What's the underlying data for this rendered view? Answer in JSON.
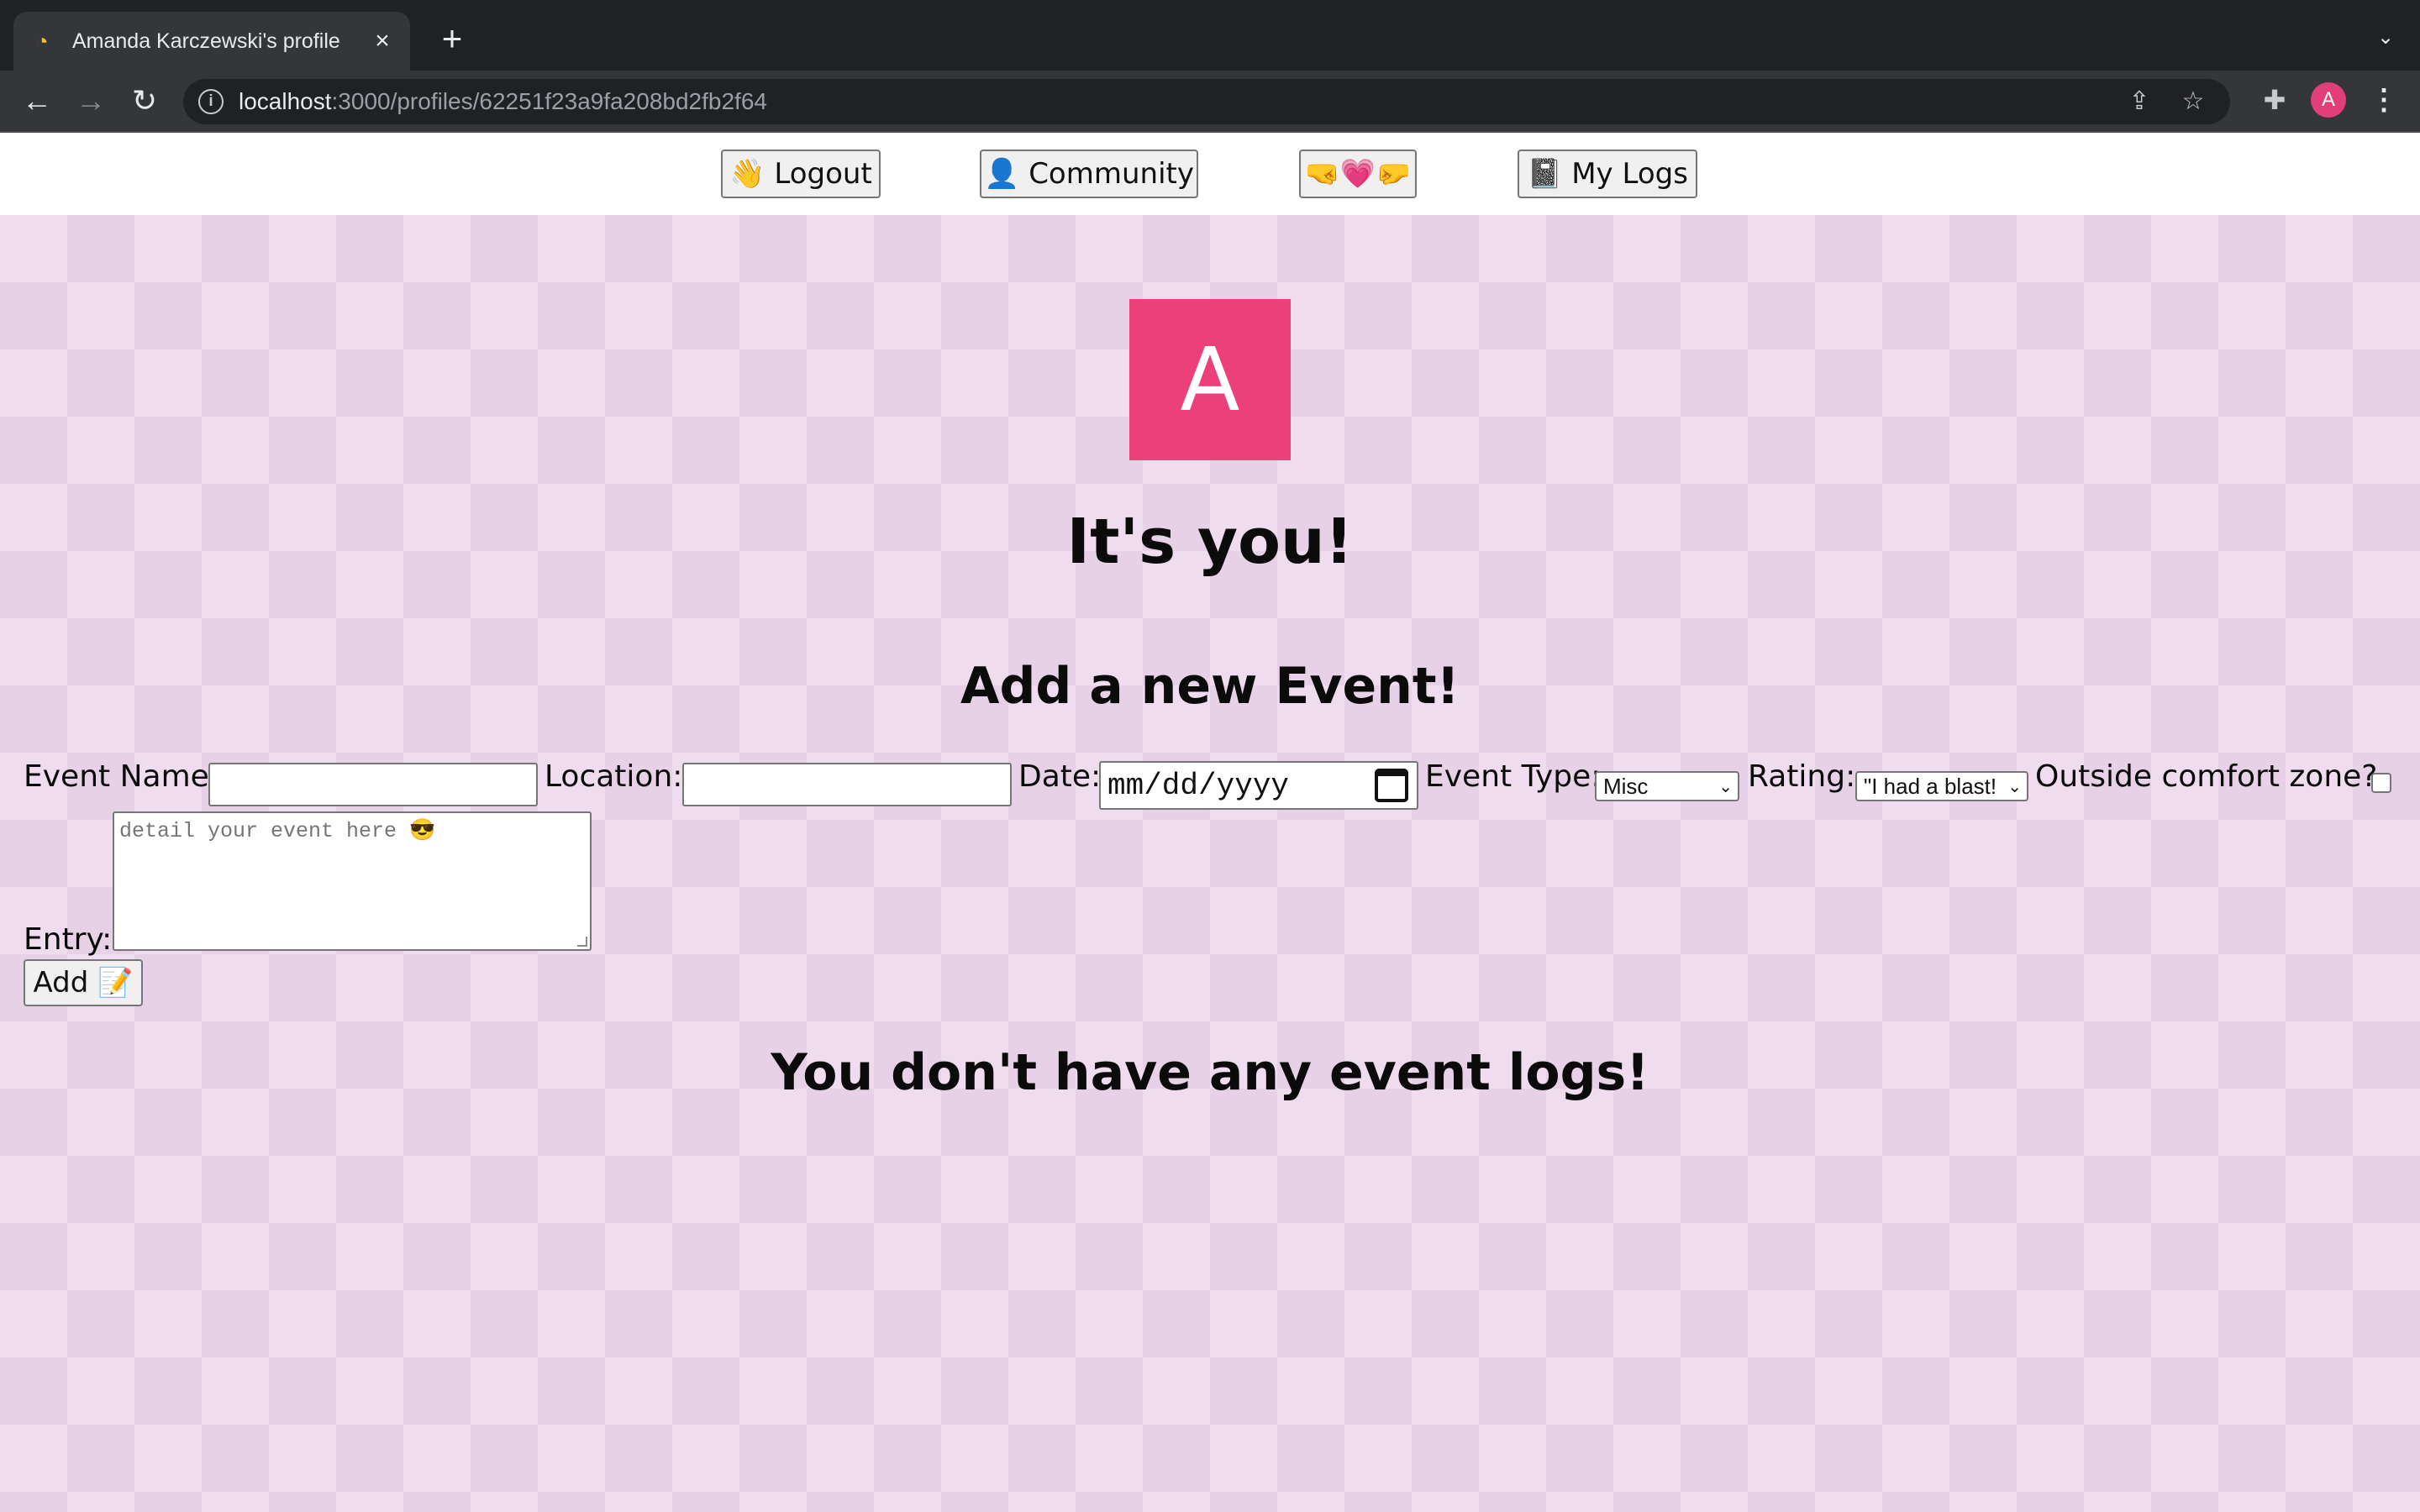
{
  "browser": {
    "tab_title": "Amanda Karczewski's profile",
    "tab_close": "×",
    "new_tab": "+",
    "url_host": "localhost",
    "url_path": ":3000/profiles/62251f23a9fa208bd2fb2f64",
    "profile_initial": "A",
    "icons": {
      "back": "←",
      "forward": "→",
      "reload": "↻",
      "info": "i",
      "share": "⇪",
      "star": "☆",
      "extensions": "✚",
      "menu": "⋮",
      "tab_menu": "⌄"
    }
  },
  "nav": {
    "logout": "👋 Logout",
    "community": "👤 Community",
    "love": "🤜💗🤛",
    "my_logs": "📓 My Logs"
  },
  "profile": {
    "avatar_letter": "A",
    "avatar_color": "#ec407a",
    "heading": "It's you!"
  },
  "form": {
    "heading": "Add a new Event!",
    "event_name_label": "Event Name:",
    "location_label": "Location:",
    "date_label": "Date:",
    "date_placeholder": "mm/dd/yyyy",
    "event_type_label": "Event Type:",
    "event_type_value": "Misc",
    "rating_label": "Rating:",
    "rating_value": "\"I had a blast!",
    "comfort_label": "Outside comfort zone?",
    "entry_label": "Entry:",
    "entry_placeholder": "detail your event here 😎",
    "add_button": "Add 📝"
  },
  "logs": {
    "empty_message": "You don't have any event logs!"
  }
}
